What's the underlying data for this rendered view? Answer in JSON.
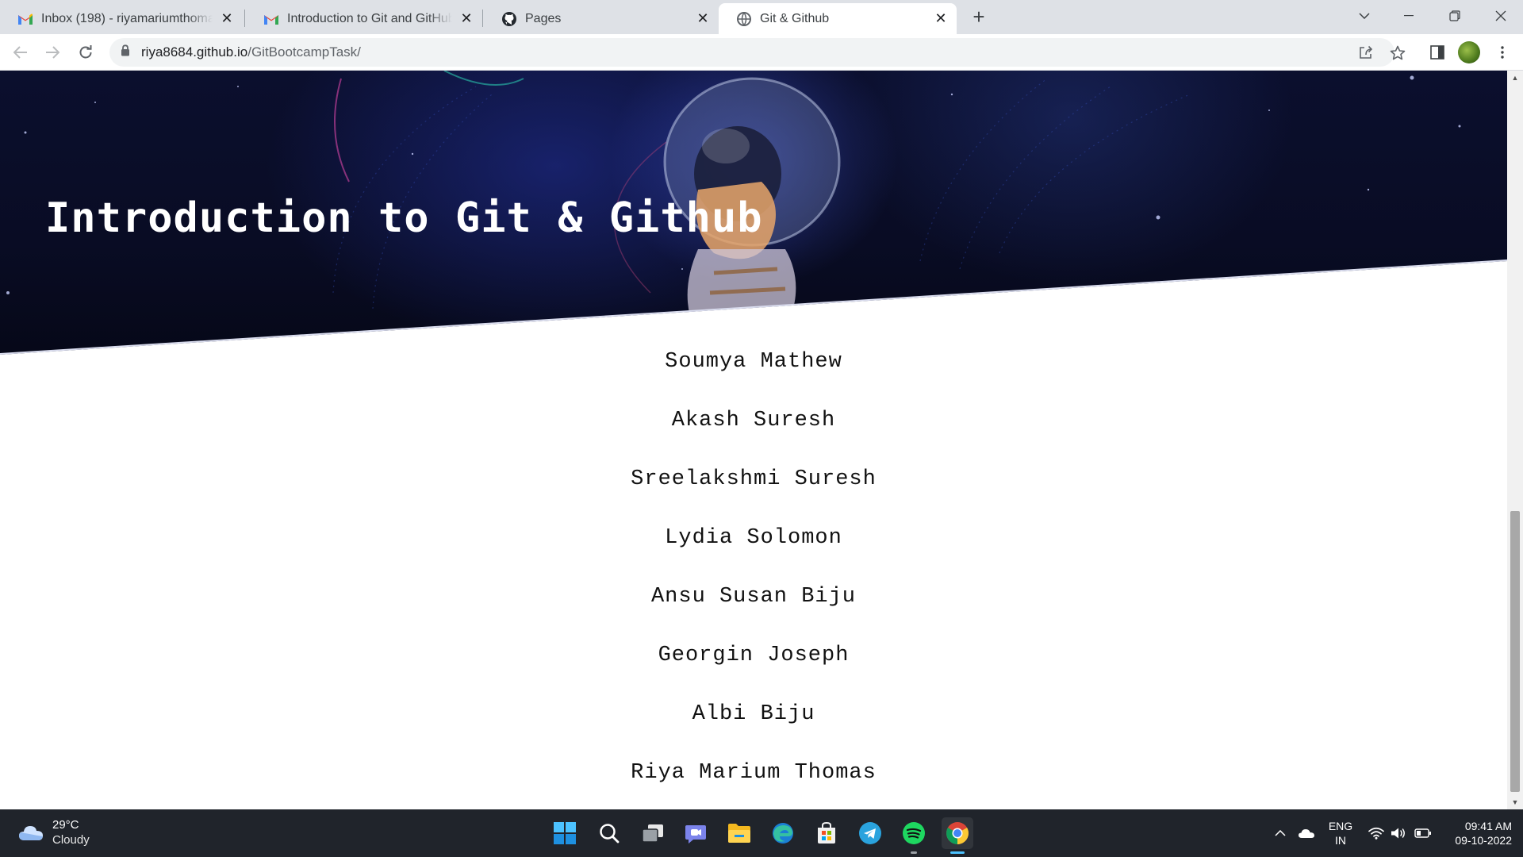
{
  "browser": {
    "tabs": [
      {
        "title": "Inbox (198) - riyamariumthomas@",
        "favicon": "gmail-icon",
        "active": false
      },
      {
        "title": "Introduction to Git and GitHub -",
        "favicon": "gmail-icon",
        "active": false
      },
      {
        "title": "Pages",
        "favicon": "github-icon",
        "active": false
      },
      {
        "title": "Git & Github",
        "favicon": "globe-icon",
        "active": true
      }
    ],
    "url_host": "riya8684.github.io",
    "url_path": "/GitBootcampTask/"
  },
  "page": {
    "hero_title": "Introduction to Git & Github",
    "names": [
      "Soumya Mathew",
      "Akash Suresh",
      "Sreelakshmi Suresh",
      "Lydia Solomon",
      "Ansu Susan Biju",
      "Georgin Joseph",
      "Albi Biju",
      "Riya Marium Thomas"
    ]
  },
  "taskbar": {
    "weather_temp": "29°C",
    "weather_condition": "Cloudy",
    "lang_line1": "ENG",
    "lang_line2": "IN",
    "time": "09:41 AM",
    "date": "09-10-2022",
    "pinned_apps": [
      "start-button",
      "search-icon",
      "task-view-icon",
      "teams-chat-icon",
      "file-explorer-icon",
      "edge-icon",
      "microsoft-store-icon",
      "telegram-icon",
      "spotify-icon",
      "chrome-icon"
    ]
  },
  "colors": {
    "hero_bg": "#0b0f2e",
    "taskbar_bg": "#20242b",
    "accent": "#4cc2ff"
  }
}
